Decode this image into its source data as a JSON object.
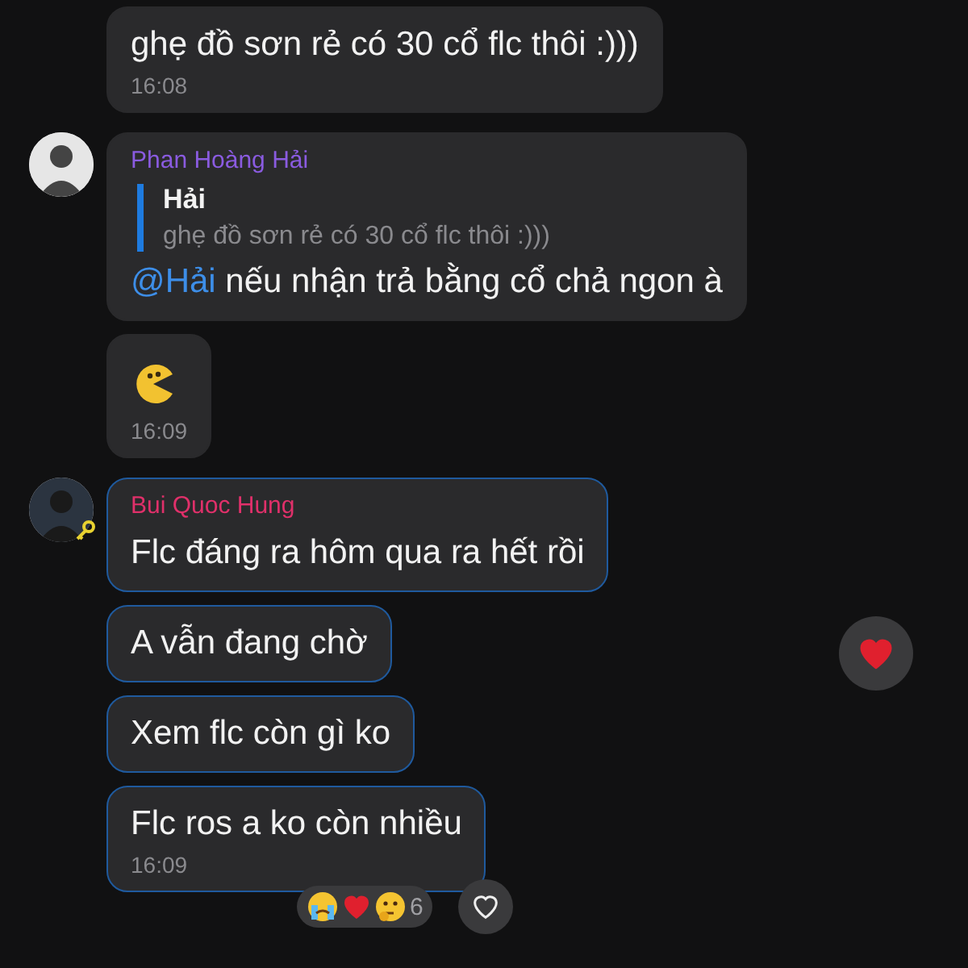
{
  "groups": [
    {
      "avatar": false,
      "messages": [
        {
          "kind": "text",
          "text": "ghẹ đồ sơn rẻ có 30 cổ flc thôi :)))",
          "time": "16:08",
          "highlighted": false
        }
      ]
    },
    {
      "sender": "Phan Hoàng Hải",
      "color": "#8a5be0",
      "avatar": true,
      "avatar_badge": false,
      "messages": [
        {
          "kind": "reply",
          "quote_author": "Hải",
          "quote_text": "ghẹ đồ sơn rẻ có 30 cổ flc thôi :)))",
          "mention": "@Hải",
          "text": "nếu nhận trả bằng cổ chả ngon à",
          "highlighted": false
        },
        {
          "kind": "sticker",
          "time": "16:09",
          "highlighted": false
        }
      ]
    },
    {
      "sender": "Bui Quoc Hung",
      "color": "#e0306a",
      "avatar": true,
      "avatar_badge": true,
      "side_reaction": true,
      "messages": [
        {
          "kind": "text",
          "text": "Flc đáng ra hôm qua ra hết rồi",
          "highlighted": true
        },
        {
          "kind": "text",
          "text": "A vẫn đang chờ",
          "highlighted": true
        },
        {
          "kind": "text",
          "text": "Xem flc còn gì ko",
          "highlighted": true
        },
        {
          "kind": "text",
          "text": "Flc ros a ko còn nhiều",
          "time": "16:09",
          "highlighted": true,
          "reactions": {
            "count": "6"
          }
        }
      ]
    }
  ]
}
